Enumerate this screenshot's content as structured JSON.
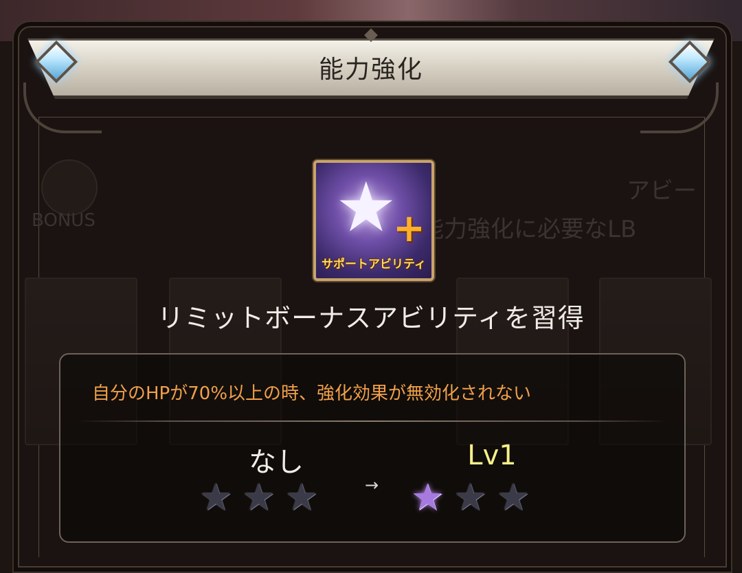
{
  "header": {
    "title": "能力強化"
  },
  "background_ghost": {
    "bonus_label": "BONUS",
    "ability_label": "アビー",
    "requirement_text": "能力強化に必要なLB"
  },
  "ability": {
    "icon_caption": "サポートアビリティ",
    "icon_name": "support-ability-star-plus-icon",
    "name": "リミットボーナスアビリティを習得"
  },
  "details": {
    "description": "自分のHPが70%以上の時、強化効果が無効化されない",
    "before": {
      "label": "なし",
      "stars_filled": 0,
      "stars_total": 3
    },
    "arrow": "→",
    "after": {
      "label": "Lv1",
      "stars_filled": 1,
      "stars_total": 3
    }
  },
  "colors": {
    "description_text": "#f0a04a",
    "after_level_text": "#f7f08a",
    "filled_star": "#a77ae0",
    "empty_star": "#3b3a48"
  }
}
